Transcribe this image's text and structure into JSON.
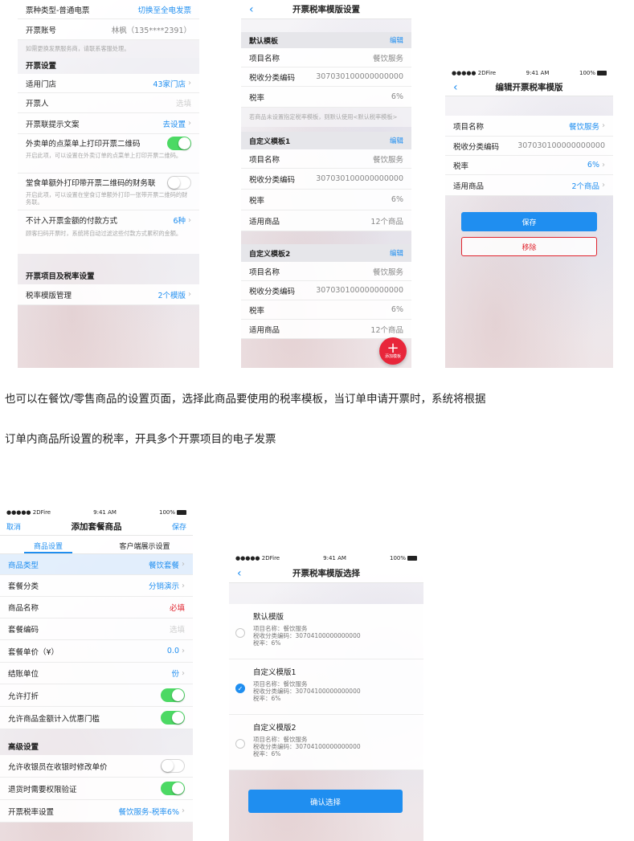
{
  "screen1": {
    "rows_top": [
      {
        "label": "票种类型-普通电票",
        "value": "切换至全电发票"
      },
      {
        "label": "开票账号",
        "value": "林枫（135****2391）"
      }
    ],
    "account_note": "如需更换发票服务商，请联系客服处理。",
    "section_invoice_settings": "开票设置",
    "store_label": "适用门店",
    "store_value": "43家门店",
    "issuer_label": "开票人",
    "issuer_value": "选填",
    "hint_label": "开票联提示文案",
    "hint_value": "去设置",
    "takeout_label": "外卖单的点菜单上打印开票二维码",
    "takeout_note": "开启此项，可以设置在外卖订单的点菜单上打印开票二维码。",
    "dinein_label": "堂食单额外打印带开票二维码的财务联",
    "dinein_note": "开启此项，可以设置在堂食订单额外打印一张带开票二维码的财务联。",
    "payment_label": "不计入开票金额的付款方式",
    "payment_value": "6种",
    "payment_note": "顾客扫码开票时，系统将自动过滤这些付款方式累积的金额。",
    "section_items_tax": "开票项目及税率设置",
    "template_label": "税率模版管理",
    "template_value": "2个模版"
  },
  "screen2": {
    "title": "开票税率模版设置",
    "edit_label": "编辑",
    "default_header": "默认模板",
    "default_rows": [
      {
        "label": "项目名称",
        "value": "餐饮服务"
      },
      {
        "label": "税收分类编码",
        "value": "307030100000000000"
      },
      {
        "label": "税率",
        "value": "6%"
      }
    ],
    "default_note": "若商品未设置指定税率模板，则默认使用<默认税率模板>",
    "custom1_header": "自定义模板1",
    "custom1_rows": [
      {
        "label": "项目名称",
        "value": "餐饮服务"
      },
      {
        "label": "税收分类编码",
        "value": "307030100000000000"
      },
      {
        "label": "税率",
        "value": "6%"
      },
      {
        "label": "适用商品",
        "value": "12个商品"
      }
    ],
    "custom2_header": "自定义模板2",
    "custom2_rows": [
      {
        "label": "项目名称",
        "value": "餐饮服务"
      },
      {
        "label": "税收分类编码",
        "value": "307030100000000000"
      },
      {
        "label": "税率",
        "value": "6%"
      },
      {
        "label": "适用商品",
        "value": "12个商品"
      }
    ],
    "fab_label": "添加模板"
  },
  "screen3": {
    "carrier": "●●●●● 2DFire",
    "time": "9:41 AM",
    "battery": "100%",
    "title": "编辑开票税率模版",
    "rows": [
      {
        "label": "项目名称",
        "value": "餐饮服务"
      },
      {
        "label": "税收分类编码",
        "value": "307030100000000000"
      },
      {
        "label": "税率",
        "value": "6%"
      },
      {
        "label": "适用商品",
        "value": "2个商品"
      }
    ],
    "save": "保存",
    "remove": "移除"
  },
  "description": {
    "line1": "也可以在餐饮/零售商品的设置页面，选择此商品要使用的税率模板，当订单申请开票时，系统将根据",
    "line2": "订单内商品所设置的税率，开具多个开票项目的电子发票"
  },
  "screen4": {
    "carrier": "●●●●● 2DFire",
    "time": "9:41 AM",
    "battery": "100%",
    "cancel": "取消",
    "title": "添加套餐商品",
    "save": "保存",
    "tabs": [
      "商品设置",
      "客户端展示设置"
    ],
    "rows": [
      {
        "label": "商品类型",
        "value": "餐饮套餐"
      },
      {
        "label": "套餐分类",
        "value": "分销演示"
      },
      {
        "label": "商品名称",
        "value": "必填"
      },
      {
        "label": "套餐编码",
        "value": "选填"
      },
      {
        "label": "套餐单价（¥）",
        "value": "0.0"
      },
      {
        "label": "结账单位",
        "value": "份"
      }
    ],
    "allow_print": "允许打折",
    "allow_discount_threshold": "允许商品金额计入优惠门槛",
    "advanced": "高级设置",
    "cashier_modify": "允许收银员在收银时修改单价",
    "refund_verify": "退货时需要权限验证",
    "tax_setting_label": "开票税率设置",
    "tax_setting_value": "餐饮服务-税率6%"
  },
  "screen5": {
    "carrier": "●●●●● 2DFire",
    "time": "9:41 AM",
    "battery": "100%",
    "title": "开票税率模版选择",
    "options": [
      {
        "title": "默认模版",
        "name": "项目名称：餐饮服务",
        "code": "税收分类编码：30704100000000000",
        "rate": "税率：6%"
      },
      {
        "title": "自定义模版1",
        "name": "项目名称：餐饮服务",
        "code": "税收分类编码：30704100000000000",
        "rate": "税率：6%"
      },
      {
        "title": "自定义模版2",
        "name": "项目名称：餐饮服务",
        "code": "税收分类编码：30704100000000000",
        "rate": "税率：6%"
      }
    ],
    "confirm": "确认选择"
  },
  "colors": {
    "accent": "#1f8ef0",
    "toggle_on": "#4cd964",
    "danger": "#e0242e"
  }
}
